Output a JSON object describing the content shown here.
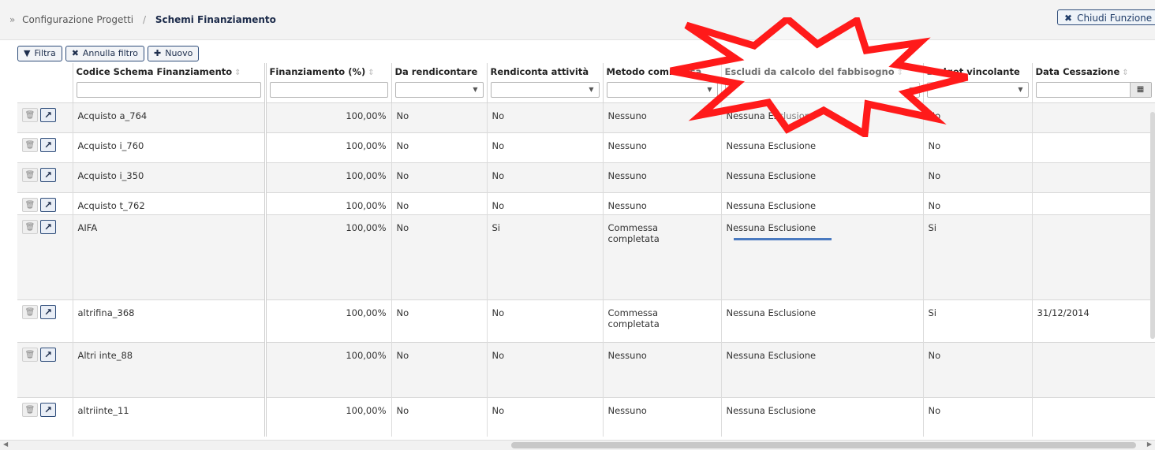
{
  "breadcrumb": {
    "prefix": "»",
    "parent": "Configurazione Progetti",
    "separator": "/",
    "current": "Schemi Finanziamento"
  },
  "close_button": {
    "icon": "close-icon",
    "label": "Chiudi Funzione"
  },
  "toolbar": {
    "filter_label": "Filtra",
    "cancel_filter_label": "Annulla filtro",
    "new_label": "Nuovo"
  },
  "table": {
    "columns": [
      {
        "label": "Codice Schema Finanziamento"
      },
      {
        "label": "Finanziamento (%)"
      },
      {
        "label": "Da rendicontare"
      },
      {
        "label": "Rendiconta attività"
      },
      {
        "label": "Metodo commessa"
      },
      {
        "label": "Escludi da calcolo del fabbisogno"
      },
      {
        "label": "Budget vincolante"
      },
      {
        "label": "Data Cessazione"
      }
    ],
    "rows": [
      {
        "codice": "Acquisto a_764",
        "finanziamento": "100,00%",
        "da_rendicontare": "No",
        "rendiconta": "No",
        "metodo": "Nessuno",
        "escludi": "Nessuna Esclusione",
        "budget": "No",
        "data": ""
      },
      {
        "codice": "Acquisto i_760",
        "finanziamento": "100,00%",
        "da_rendicontare": "No",
        "rendiconta": "No",
        "metodo": "Nessuno",
        "escludi": "Nessuna Esclusione",
        "budget": "No",
        "data": ""
      },
      {
        "codice": "Acquisto i_350",
        "finanziamento": "100,00%",
        "da_rendicontare": "No",
        "rendiconta": "No",
        "metodo": "Nessuno",
        "escludi": "Nessuna Esclusione",
        "budget": "No",
        "data": ""
      },
      {
        "codice": "Acquisto t_762",
        "finanziamento": "100,00%",
        "da_rendicontare": "No",
        "rendiconta": "No",
        "metodo": "Nessuno",
        "escludi": "Nessuna Esclusione",
        "budget": "No",
        "data": ""
      },
      {
        "codice": "AIFA",
        "finanziamento": "100,00%",
        "da_rendicontare": "No",
        "rendiconta": "Si",
        "metodo": "Commessa completata",
        "escludi": "Nessuna Esclusione",
        "budget": "Si",
        "data": ""
      },
      {
        "codice": "altrifina_368",
        "finanziamento": "100,00%",
        "da_rendicontare": "No",
        "rendiconta": "No",
        "metodo": "Commessa completata",
        "escludi": "Nessuna Esclusione",
        "budget": "Si",
        "data": "31/12/2014"
      },
      {
        "codice": "Altri inte_88",
        "finanziamento": "100,00%",
        "da_rendicontare": "No",
        "rendiconta": "No",
        "metodo": "Nessuno",
        "escludi": "Nessuna Esclusione",
        "budget": "No",
        "data": ""
      },
      {
        "codice": "altriinte_11",
        "finanziamento": "100,00%",
        "da_rendicontare": "No",
        "rendiconta": "No",
        "metodo": "Nessuno",
        "escludi": "Nessuna Esclusione",
        "budget": "No",
        "data": ""
      }
    ]
  },
  "colors": {
    "accent": "#2f4d7a",
    "annotation_red": "#ff1a1a",
    "underline_blue": "#4a7ac0"
  }
}
